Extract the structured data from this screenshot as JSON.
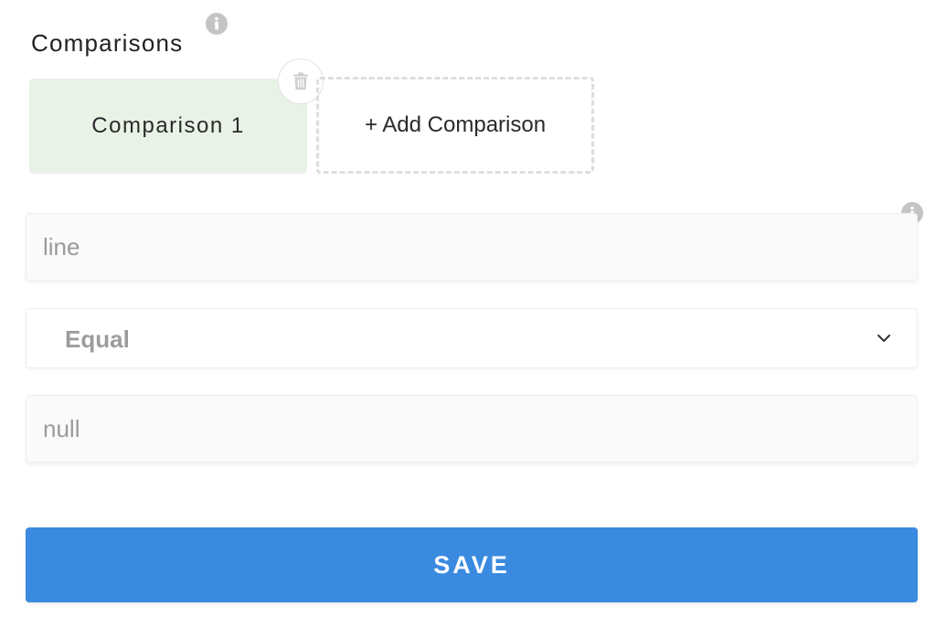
{
  "section": {
    "title": "Comparisons"
  },
  "comparisons": {
    "items": [
      {
        "label": "Comparison 1"
      }
    ],
    "add_label": "+ Add Comparison"
  },
  "form": {
    "field_value": "line",
    "operator": "Equal",
    "compare_value": "null"
  },
  "actions": {
    "save_label": "SAVE"
  },
  "colors": {
    "accent": "#3a8ae0",
    "selected_card": "#e8f2e6"
  },
  "icons": {
    "info": "info-icon",
    "delete": "trash-icon",
    "dropdown": "chevron-down-icon"
  }
}
